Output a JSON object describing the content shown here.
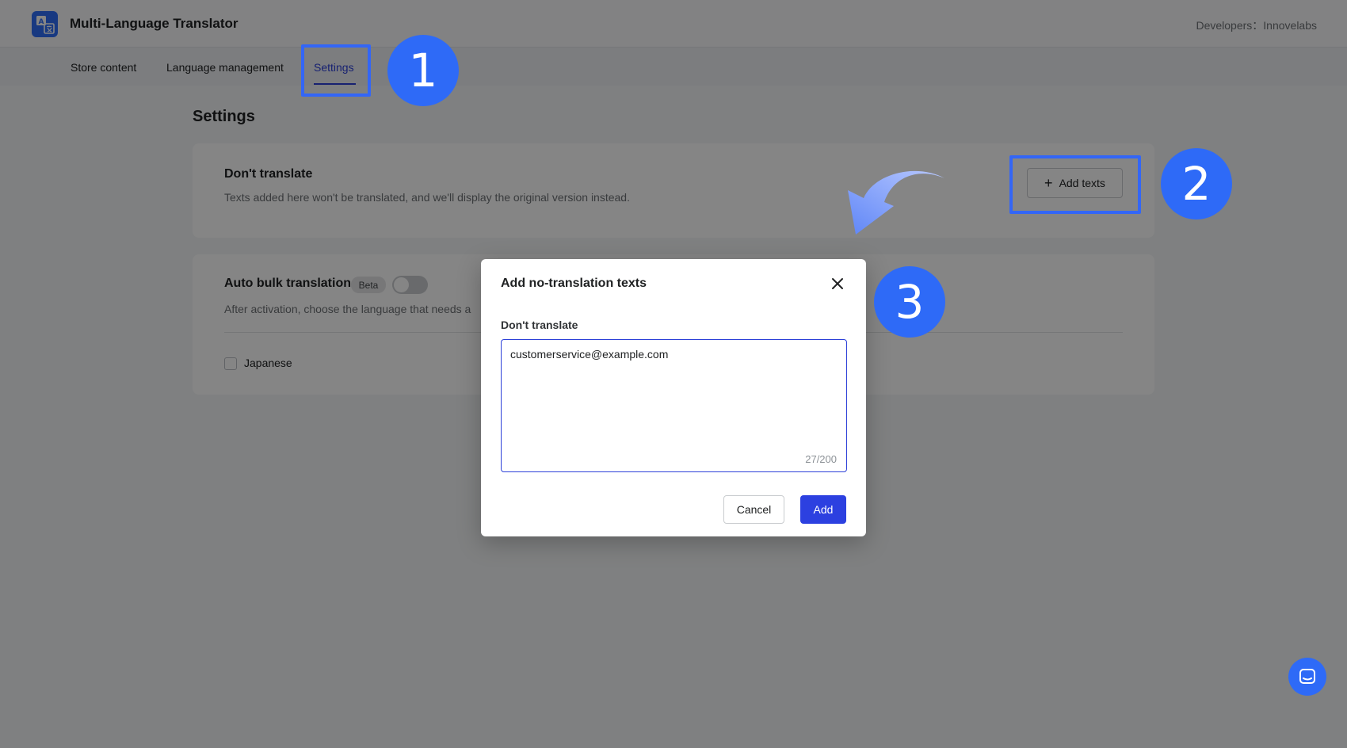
{
  "header": {
    "app_title": "Multi-Language Translator",
    "developer": "Developers：Innovelabs",
    "logo_icon": "translate-icon"
  },
  "tabs": [
    {
      "label": "Store content",
      "active": false
    },
    {
      "label": "Language management",
      "active": false
    },
    {
      "label": "Settings",
      "active": true
    }
  ],
  "page": {
    "title": "Settings"
  },
  "dont_translate_card": {
    "heading": "Don't translate",
    "description": "Texts added here won't be translated, and we'll display the original version instead.",
    "add_button_label": "Add texts",
    "add_button_icon": "plus-icon"
  },
  "auto_bulk_card": {
    "heading": "Auto bulk translation",
    "badge": "Beta",
    "toggle_on": false,
    "description": "After activation, choose the language that needs a",
    "languages": [
      {
        "label": "Japanese",
        "checked": false
      }
    ]
  },
  "modal": {
    "title": "Add no-translation texts",
    "field_label": "Don't translate",
    "textarea_value": "customerservice@example.com",
    "char_count": "27/200",
    "cancel_label": "Cancel",
    "add_label": "Add",
    "close_icon": "close-icon"
  },
  "annotations": {
    "step_1": "1",
    "step_2": "2",
    "step_3": "3",
    "color": "#2e6af7"
  },
  "colors": {
    "accent": "#2c40d8",
    "primary_button": "#2c40e0",
    "logo": "#2e6ef7"
  },
  "chat_widget": {
    "icon": "chat-icon"
  }
}
